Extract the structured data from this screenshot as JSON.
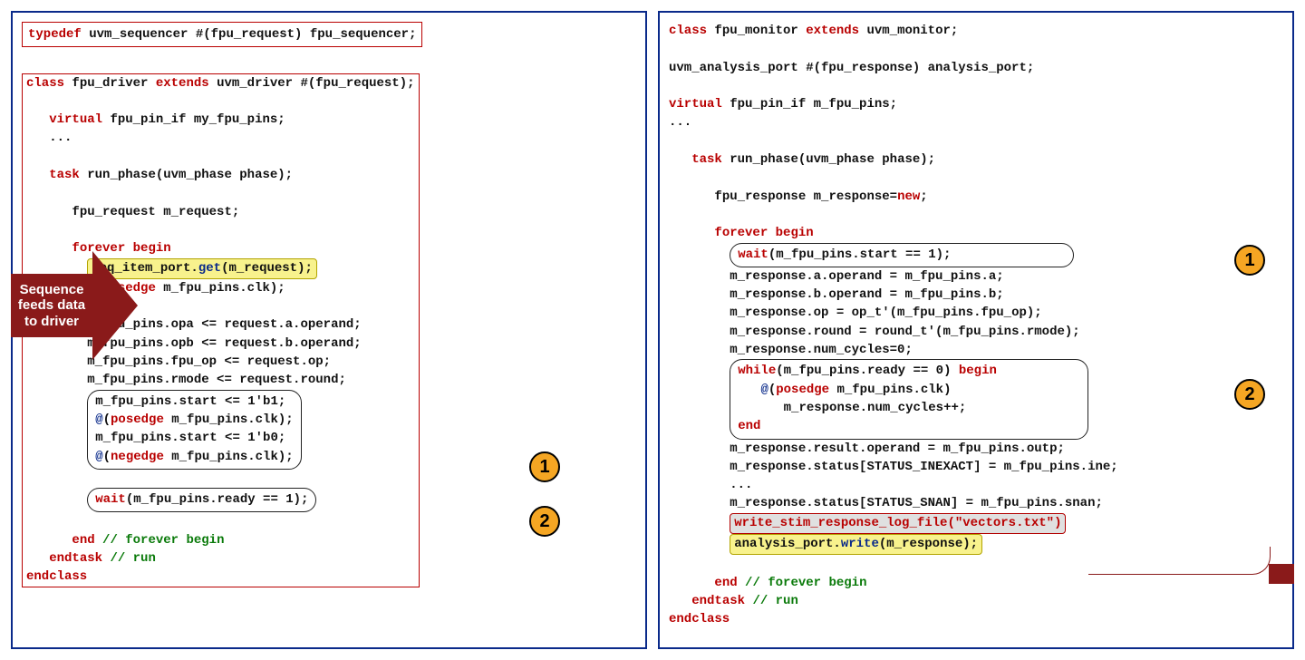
{
  "left": {
    "typedef": {
      "kw": "typedef",
      "body": "uvm_sequencer #(fpu_request) fpu_sequencer;"
    },
    "classline": {
      "pre": "class ",
      "name": "fpu_driver",
      "ext": " extends ",
      "base": "uvm_driver #(fpu_request);"
    },
    "virtual": {
      "kw": "virtual ",
      "rest": "fpu_pin_if my_fpu_pins;"
    },
    "dots": "...",
    "task": {
      "kw": "task ",
      "rest": "run_phase(uvm_phase phase);"
    },
    "req": "fpu_request m_request;",
    "forever": {
      "kw": "forever ",
      "beg": "begin"
    },
    "seqi_pre": "seq_item_port.",
    "seqi_call": "get",
    "seqi_post": "(m_request);",
    "at1": {
      "at": "@",
      "edge": "posedge",
      "rest": " m_fpu_pins.clk);"
    },
    "assign1": "m_fpu_pins.opa <= request.a.operand;",
    "assign2": "m_fpu_pins.opb <= request.b.operand;",
    "assign3": "m_fpu_pins.fpu_op <= request.op;",
    "assign4": "m_fpu_pins.rmode <= request.round;",
    "b1_l1": "m_fpu_pins.start <= 1'b1;",
    "b1_l2_edge": "posedge",
    "b1_l2_rest": " m_fpu_pins.clk);",
    "b1_l3": "m_fpu_pins.start <= 1'b0;",
    "b1_l4_edge": "negedge",
    "b1_l4_rest": " m_fpu_pins.clk);",
    "wait_kw": "wait",
    "wait_body": "(m_fpu_pins.ready == 1);",
    "end": "end",
    "endcmt1": "// forever begin",
    "endtask": "endtask",
    "endcmt2": "// run",
    "endclass": "endclass",
    "arrow_text": "Sequence feeds data to driver",
    "c1": "1",
    "c2": "2"
  },
  "right": {
    "classline": {
      "pre": "class ",
      "name": "fpu_monitor",
      "ext": " extends ",
      "base": "uvm_monitor;"
    },
    "analysis": "uvm_analysis_port #(fpu_response) analysis_port;",
    "virtual": {
      "kw": "virtual ",
      "rest": "fpu_pin_if m_fpu_pins;"
    },
    "dots": "...",
    "task": {
      "kw": "task ",
      "rest": "run_phase(uvm_phase phase);"
    },
    "resp": {
      "txt": "fpu_response m_response=",
      "newkw": "new",
      "semi": ";"
    },
    "forever": {
      "kw": "forever ",
      "beg": "begin"
    },
    "b1_wait_kw": "wait",
    "b1_wait_body": "(m_fpu_pins.start == 1);",
    "a1": "m_response.a.operand = m_fpu_pins.a;",
    "a2": "m_response.b.operand = m_fpu_pins.b;",
    "a3": "m_response.op = op_t'(m_fpu_pins.fpu_op);",
    "a4": "m_response.round = round_t'(m_fpu_pins.rmode);",
    "a5": "m_response.num_cycles=0;",
    "b2_while_kw": "while",
    "b2_while_cond": "(m_fpu_pins.ready == 0) ",
    "b2_begin": "begin",
    "b2_at": "@",
    "b2_edge": "posedge",
    "b2_rest": " m_fpu_pins.clk)",
    "b2_inc": "m_response.num_cycles++;",
    "b2_end": "end",
    "r1": "m_response.result.operand = m_fpu_pins.outp;",
    "r2": "m_response.status[STATUS_INEXACT] = m_fpu_pins.ine;",
    "rdots": "...",
    "r3": "m_response.status[STATUS_SNAN] = m_fpu_pins.snan;",
    "greyline": "write_stim_response_log_file(\"vectors.txt\")",
    "ap_pre": "analysis_port.",
    "ap_call": "write",
    "ap_post": "(m_response);",
    "end": "end",
    "endcmt1": "// forever begin",
    "endtask": "endtask",
    "endcmt2": "// run",
    "endclass": "endclass",
    "c1": "1",
    "c2": "2"
  }
}
